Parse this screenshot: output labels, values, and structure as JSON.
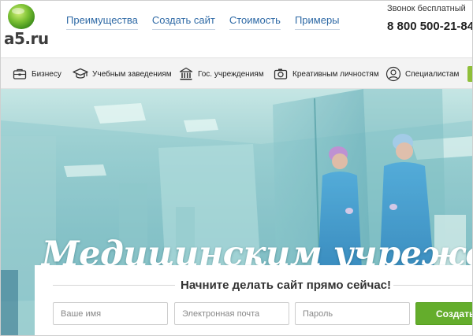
{
  "brand": {
    "logo_text": "a5.ru"
  },
  "nav": {
    "items": [
      {
        "label": "Преимущества"
      },
      {
        "label": "Создать сайт"
      },
      {
        "label": "Стоимость"
      },
      {
        "label": "Примеры"
      }
    ]
  },
  "contact": {
    "note": "Звонок бесплатный",
    "phone": "8 800 500-21-84"
  },
  "categories": {
    "items": [
      {
        "label": "Бизнесу",
        "icon": "briefcase-icon"
      },
      {
        "label": "Учебным заведениям",
        "icon": "graduation-cap-icon"
      },
      {
        "label": "Гос. учреждениям",
        "icon": "government-building-icon"
      },
      {
        "label": "Креативным личностям",
        "icon": "camera-icon"
      },
      {
        "label": "Специалистам",
        "icon": "person-icon"
      }
    ]
  },
  "hero": {
    "title": "Медицинским учреждениям"
  },
  "signup": {
    "title": "Начните делать сайт прямо сейчас!",
    "name_placeholder": "Ваше имя",
    "email_placeholder": "Электронная почта",
    "password_placeholder": "Пароль",
    "submit_label": "Создать"
  },
  "colors": {
    "link": "#2f6aa6",
    "accent_green": "#64ad2c"
  }
}
